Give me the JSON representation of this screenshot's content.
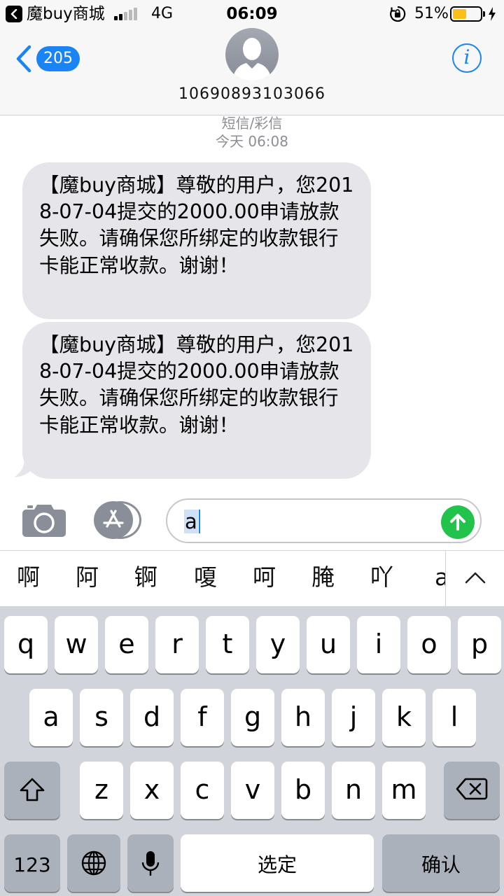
{
  "status_bar": {
    "app_name": "魔buy商城",
    "network": "4G",
    "time": "06:09",
    "battery_percent": "51%",
    "battery_level": 0.51,
    "signal_bars": 2,
    "battery_color": "#f9c01a"
  },
  "nav": {
    "back_count": "205",
    "contact_number": "10690893103066",
    "info_icon": "i",
    "accent_color": "#1a84f5"
  },
  "conversation": {
    "message_type": "短信/彩信",
    "timestamp": "今天 06:08",
    "messages": [
      {
        "text": "【魔buy商城】尊敬的用户，您2018-07-04提交的2000.00申请放款失败。请确保您所绑定的收款银行卡能正常收款。谢谢！"
      },
      {
        "text": "【魔buy商城】尊敬的用户，您2018-07-04提交的2000.00申请放款失败。请确保您所绑定的收款银行卡能正常收款。谢谢！"
      }
    ]
  },
  "input_bar": {
    "text": "a",
    "send_color": "#22c34a"
  },
  "candidates": [
    "啊",
    "阿",
    "锕",
    "嗄",
    "呵",
    "腌",
    "吖",
    "a"
  ],
  "keyboard": {
    "row1": [
      "q",
      "w",
      "e",
      "r",
      "t",
      "y",
      "u",
      "i",
      "o",
      "p"
    ],
    "row2": [
      "a",
      "s",
      "d",
      "f",
      "g",
      "h",
      "j",
      "k",
      "l"
    ],
    "row3": [
      "z",
      "x",
      "c",
      "v",
      "b",
      "n",
      "m"
    ],
    "numbers_label": "123",
    "space_label": "选定",
    "return_label": "确认"
  }
}
